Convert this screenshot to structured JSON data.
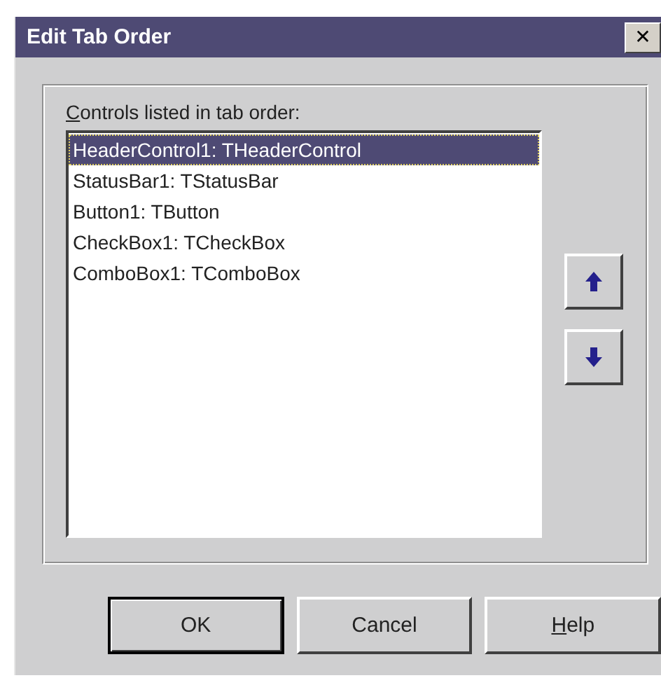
{
  "window": {
    "title": "Edit Tab Order",
    "close_glyph": "✕"
  },
  "list_label": {
    "text": "Controls listed in tab order:",
    "mnemonic_underlined": true
  },
  "items": [
    {
      "text": "HeaderControl1: THeaderControl",
      "selected": true
    },
    {
      "text": "StatusBar1: TStatusBar",
      "selected": false
    },
    {
      "text": "Button1: TButton",
      "selected": false
    },
    {
      "text": "CheckBox1: TCheckBox",
      "selected": false
    },
    {
      "text": "ComboBox1: TComboBox",
      "selected": false
    }
  ],
  "move_buttons": [
    {
      "kind": "up"
    },
    {
      "kind": "down"
    }
  ],
  "buttons": [
    {
      "label": "OK",
      "default": true,
      "mnemonic_underlined": false
    },
    {
      "label": "Cancel",
      "default": false,
      "mnemonic_underlined": false
    },
    {
      "label": "Help",
      "default": false,
      "mnemonic_underlined": true
    }
  ]
}
